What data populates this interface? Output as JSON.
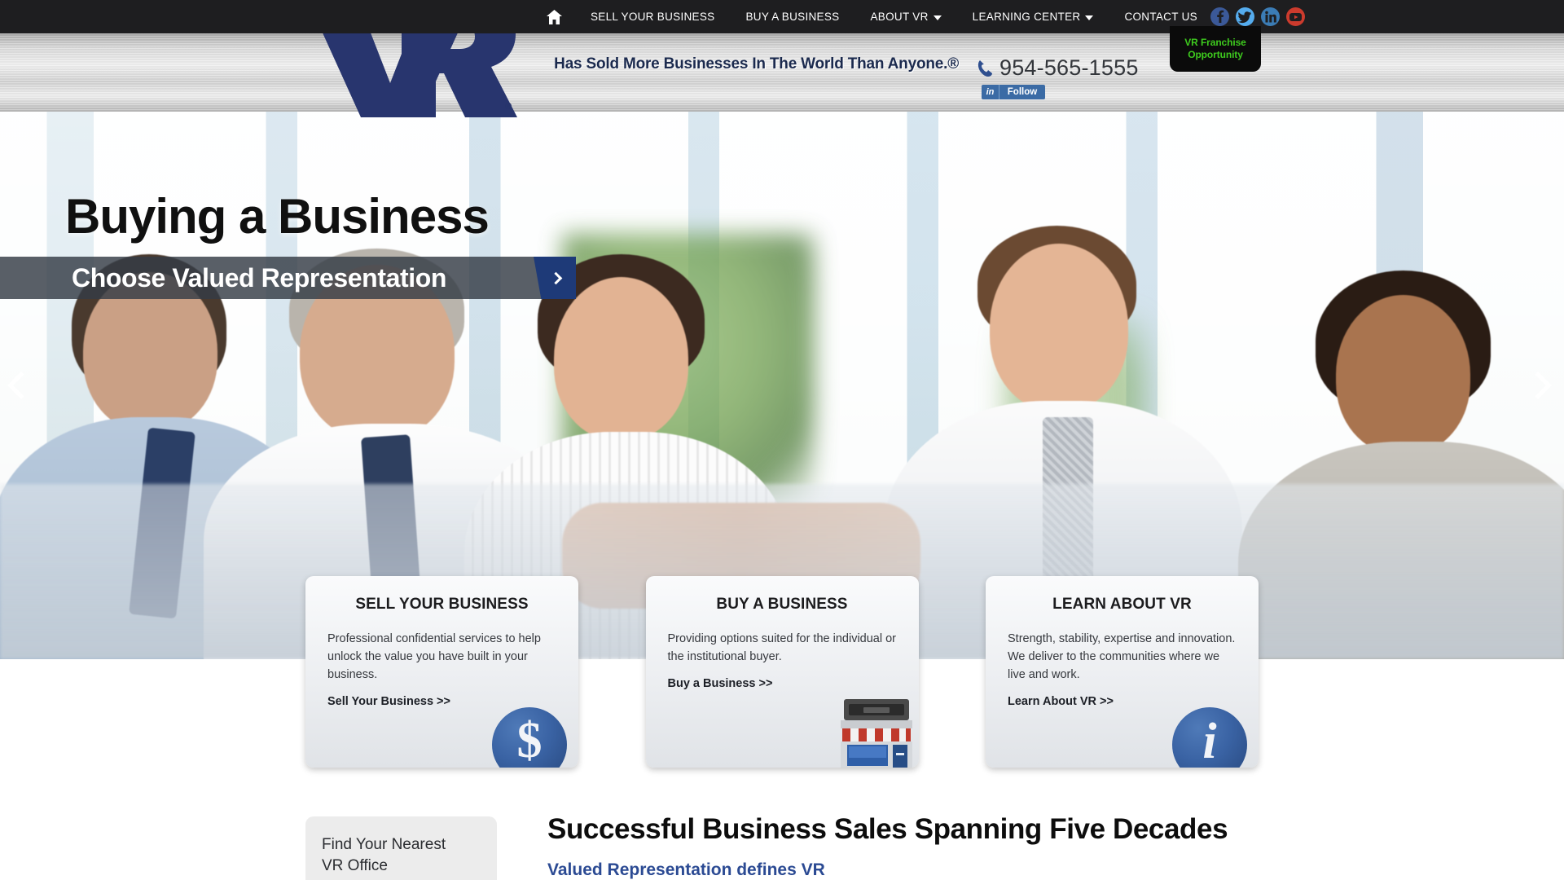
{
  "topnav": {
    "home_label": "Home",
    "items": [
      {
        "label": "SELL YOUR BUSINESS",
        "has_caret": false
      },
      {
        "label": "BUY A BUSINESS",
        "has_caret": false
      },
      {
        "label": "ABOUT VR",
        "has_caret": true
      },
      {
        "label": "LEARNING CENTER",
        "has_caret": true
      },
      {
        "label": "CONTACT US",
        "has_caret": false
      }
    ],
    "social": [
      {
        "name": "facebook",
        "color": "#3b5998"
      },
      {
        "name": "twitter",
        "color": "#55acee"
      },
      {
        "name": "linkedin",
        "color": "#3b7cb5"
      },
      {
        "name": "youtube",
        "color": "#cc3b2d"
      }
    ]
  },
  "header": {
    "logo_text": "VR",
    "registered_mark": "®",
    "tagline": "Has Sold More Businesses In The World Than Anyone.®",
    "phone": "954-565-1555",
    "linkedin_follow": {
      "icon_label": "in",
      "label": "Follow"
    },
    "franchise_badge": {
      "line1": "VR Franchise",
      "line2": "Opportunity",
      "color": "#3ecb1e"
    }
  },
  "hero": {
    "title": "Buying a Business",
    "subtitle": "Choose Valued Representation",
    "prev_label": "Previous slide",
    "next_label": "Next slide",
    "cta_label": ">"
  },
  "cards": [
    {
      "title": "SELL YOUR BUSINESS",
      "body": "Professional confidential services to help unlock the value you have built in your business.",
      "link": "Sell Your Business >>",
      "icon": "dollar-circle-icon"
    },
    {
      "title": "BUY A BUSINESS",
      "body": "Providing options suited for the individual or the institutional buyer.",
      "link": "Buy a Business >>",
      "icon": "storefront-icon"
    },
    {
      "title": "LEARN ABOUT VR",
      "body": "Strength, stability, expertise and innovation. We deliver to the communities where we live and work.",
      "link": "Learn About VR >>",
      "icon": "info-circle-icon"
    }
  ],
  "bottom": {
    "find_office_line1": "Find Your Nearest",
    "find_office_line2": "VR Office",
    "heading": "Successful Business Sales Spanning Five Decades",
    "subheading": "Valued Representation defines VR"
  },
  "colors": {
    "brand_navy": "#26356b",
    "nav_bg": "#1e1e20",
    "accent_blue": "#2b4a93",
    "badge_green": "#3ecb1e"
  }
}
